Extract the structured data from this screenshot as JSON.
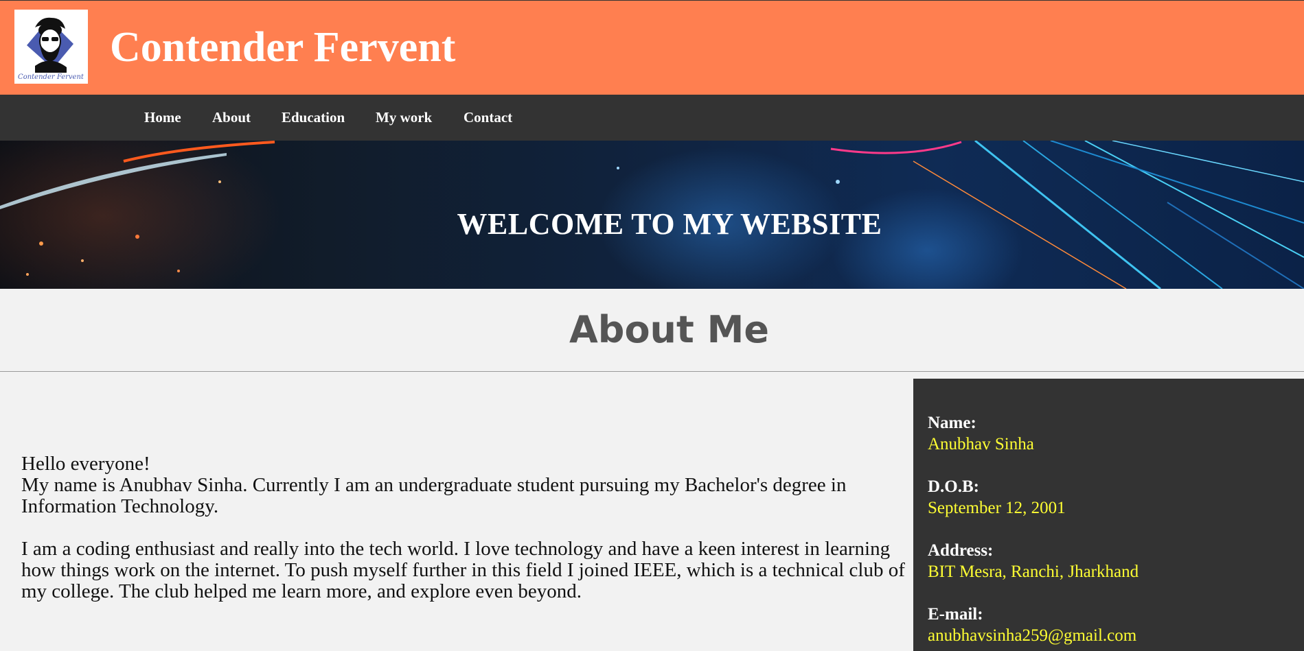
{
  "header": {
    "title": "Contender Fervent",
    "logo_text": "Contender Fervent"
  },
  "nav": {
    "items": [
      {
        "label": "Home"
      },
      {
        "label": "About"
      },
      {
        "label": "Education"
      },
      {
        "label": "My work"
      },
      {
        "label": "Contact"
      }
    ]
  },
  "banner": {
    "text": "WELCOME TO MY WEBSITE"
  },
  "about": {
    "title": "About Me",
    "bio_line1": "Hello everyone!",
    "bio_line2": "My name is Anubhav Sinha. Currently I am an undergraduate student pursuing my Bachelor's degree in Information Technology.",
    "bio_para2": "I am a coding enthusiast and really into the tech world. I love technology and have a keen interest in learning how things work on the internet. To push myself further in this field I joined IEEE, which is a technical club of my college. The club helped me learn more, and explore even beyond."
  },
  "info": {
    "name_label": "Name:",
    "name_value": "Anubhav Sinha",
    "dob_label": "D.O.B:",
    "dob_value": "September 12, 2001",
    "address_label": "Address:",
    "address_value": "BIT Mesra, Ranchi, Jharkhand",
    "email_label": "E-mail:",
    "email_value": "anubhavsinha259@gmail.com"
  },
  "colors": {
    "header_bg": "#ff7f50",
    "nav_bg": "#333333",
    "page_bg": "#f2f2f2",
    "info_value": "#ffff33",
    "about_title": "#555555"
  }
}
